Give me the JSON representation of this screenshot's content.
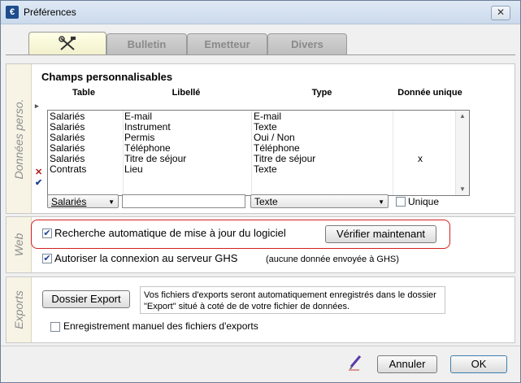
{
  "window": {
    "title": "Préférences",
    "close": "✕",
    "app_icon_glyph": "€"
  },
  "tabs": [
    {
      "label": "",
      "icon": "tools-icon",
      "active": true
    },
    {
      "label": "Bulletin",
      "active": false
    },
    {
      "label": "Emetteur",
      "active": false
    },
    {
      "label": "Divers",
      "active": false
    }
  ],
  "donnees": {
    "section_label": "Données perso.",
    "title": "Champs personnalisables",
    "columns": [
      "Table",
      "Libellé",
      "Type",
      "Donnée unique"
    ],
    "rows": [
      {
        "table": "Salariés",
        "libelle": "E-mail",
        "type": "E-mail",
        "unique": ""
      },
      {
        "table": "Salariés",
        "libelle": "Instrument",
        "type": "Texte",
        "unique": ""
      },
      {
        "table": "Salariés",
        "libelle": "Permis",
        "type": "Oui / Non",
        "unique": ""
      },
      {
        "table": "Salariés",
        "libelle": "Téléphone",
        "type": "Téléphone",
        "unique": ""
      },
      {
        "table": "Salariés",
        "libelle": "Titre de séjour",
        "type": "Titre de séjour",
        "unique": "x"
      },
      {
        "table": "Contrats",
        "libelle": "Lieu",
        "type": "Texte",
        "unique": ""
      }
    ],
    "markers": {
      "cursor": "▸",
      "delete": "✕",
      "validate": "✔"
    },
    "editor": {
      "table_select": "Salariés",
      "libelle_value": "",
      "type_select": "Texte",
      "unique_label": "Unique",
      "unique_checked": false
    }
  },
  "web": {
    "section_label": "Web",
    "auto_update_label": "Recherche automatique de mise à jour du logiciel",
    "auto_update_checked": true,
    "verify_button": "Vérifier maintenant",
    "ghs_label": "Autoriser la connexion au serveur GHS",
    "ghs_checked": true,
    "ghs_note": "(aucune donnée envoyée à GHS)",
    "highlight_color": "#d32020"
  },
  "exports": {
    "section_label": "Exports",
    "button": "Dossier Export",
    "note": "Vos fichiers d'exports seront automatiquement enregistrés dans le dossier \"Export\" situé à coté de de votre fichier de données.",
    "manual_label": "Enregistrement manuel des fichiers d'exports",
    "manual_checked": false
  },
  "footer": {
    "annuler": "Annuler",
    "ok": "OK",
    "pen_icon": "pen-icon"
  }
}
